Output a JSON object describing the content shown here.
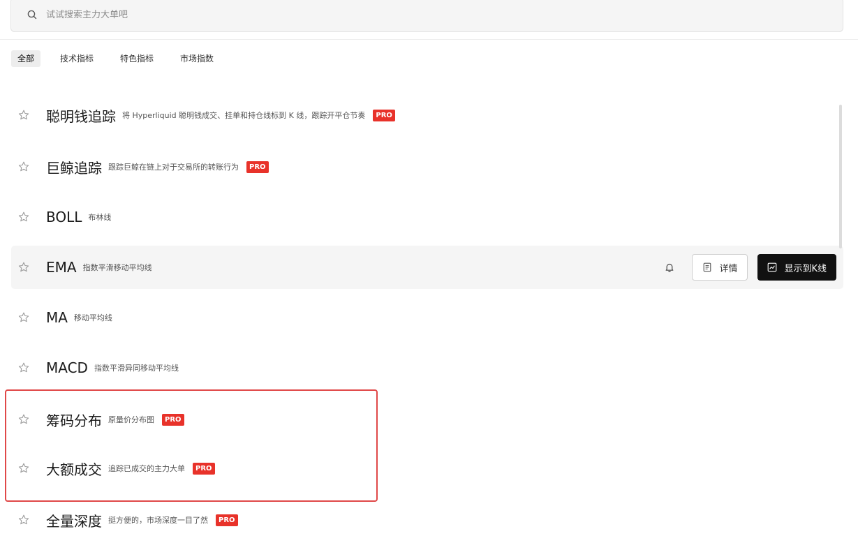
{
  "search": {
    "placeholder": "试试搜索主力大单吧"
  },
  "tabs": [
    {
      "label": "全部",
      "active": true
    },
    {
      "label": "技术指标",
      "active": false
    },
    {
      "label": "特色指标",
      "active": false
    },
    {
      "label": "市场指数",
      "active": false
    }
  ],
  "indicators": [
    {
      "name": "聪明钱追踪",
      "desc": "将 Hyperliquid 聪明钱成交、挂单和持仓线标到 K 线，跟踪开平仓节奏",
      "badge": "PRO"
    },
    {
      "name": "巨鲸追踪",
      "desc": "跟踪巨鲸在链上对于交易所的转账行为",
      "badge": "PRO"
    },
    {
      "name": "BOLL",
      "desc": "布林线",
      "badge": ""
    },
    {
      "name": "EMA",
      "desc": "指数平滑移动平均线",
      "badge": ""
    },
    {
      "name": "MA",
      "desc": "移动平均线",
      "badge": ""
    },
    {
      "name": "MACD",
      "desc": "指数平滑异同移动平均线",
      "badge": ""
    },
    {
      "name": "筹码分布",
      "desc": "原量价分布图",
      "badge": "PRO"
    },
    {
      "name": "大额成交",
      "desc": "追踪已成交的主力大单",
      "badge": "PRO"
    },
    {
      "name": "全量深度",
      "desc": "挺方便的，市场深度一目了然",
      "badge": "PRO"
    }
  ],
  "row_actions": {
    "detail_label": "详情",
    "show_label": "显示到K线"
  },
  "colors": {
    "pro_badge": "#e8322a",
    "highlight_border": "#e04848",
    "primary_button": "#111111"
  },
  "icons": {
    "search": "search-icon",
    "star": "star-outline-icon",
    "bell": "bell-icon",
    "detail": "document-icon",
    "show": "line-chart-icon"
  }
}
